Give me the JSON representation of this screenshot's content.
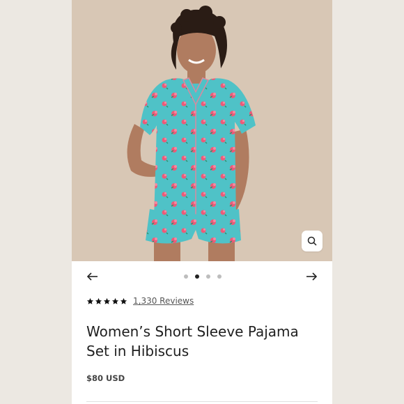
{
  "product": {
    "title_line1": "Women’s Short Sleeve Pajama",
    "title_line2": "Set in Hibiscus",
    "price": "$80 USD",
    "reviews_label": "1,330 Reviews",
    "rating_stars": 5
  },
  "gallery": {
    "image_alt": "Model wearing teal hibiscus short sleeve pajama set",
    "dot_count": 4,
    "active_dot": 1
  },
  "icons": {
    "zoom": "search-icon",
    "prev": "arrow-left-icon",
    "next": "arrow-right-icon",
    "star": "star-icon"
  },
  "colors": {
    "pajama": "#4fc2c7",
    "hibiscus": "#ec5a78",
    "background": "#d9c8b6"
  }
}
